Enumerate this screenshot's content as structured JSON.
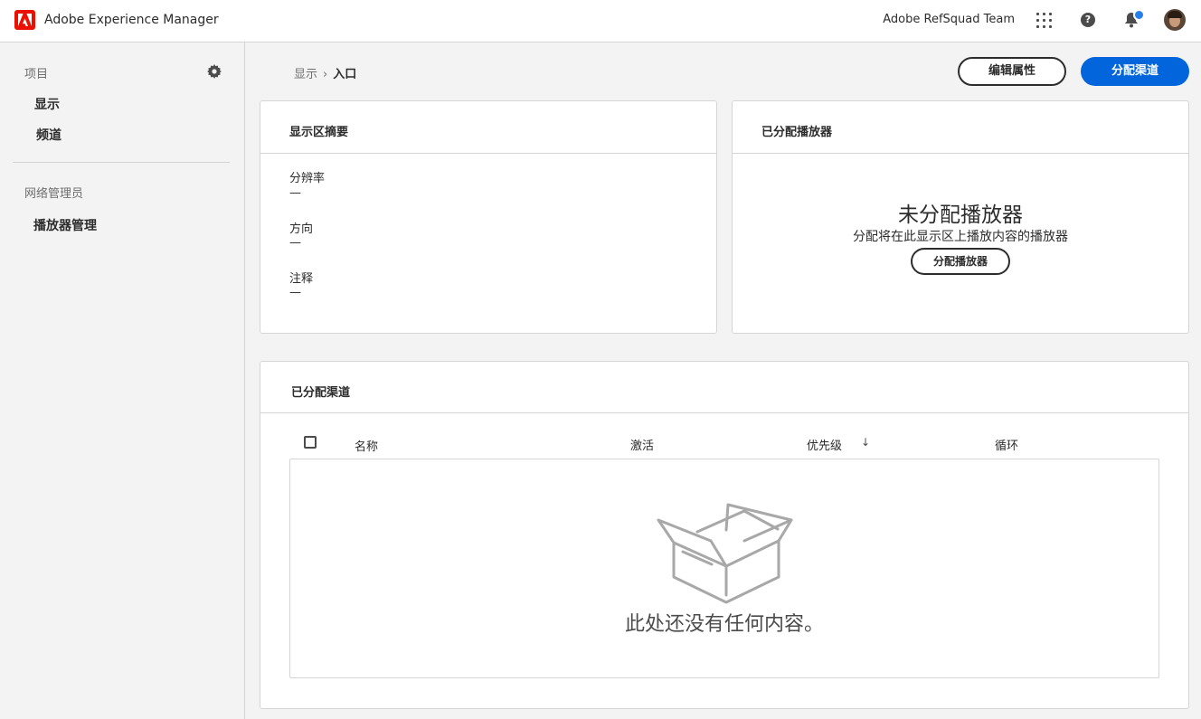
{
  "header": {
    "app_title": "Adobe Experience Manager",
    "org_name": "Adobe RefSquad Team",
    "icons": [
      "adobe-logo-icon",
      "apps-grid-icon",
      "help-icon",
      "bell-icon",
      "avatar"
    ],
    "accent": "#eb1000",
    "notification_color": "#2680eb"
  },
  "sidebar": {
    "section1_heading": "项目",
    "items": [
      {
        "label": "显示"
      },
      {
        "label": "频道"
      }
    ],
    "section2_heading": "网络管理员",
    "admin_items": [
      {
        "label": "播放器管理"
      }
    ]
  },
  "breadcrumb": {
    "parent": "显示",
    "current": "入口"
  },
  "actions": {
    "edit_properties": "编辑属性",
    "assign_channel": "分配渠道",
    "primary_color": "#0265dc"
  },
  "display_summary": {
    "title": "显示区摘要",
    "properties": [
      {
        "label": "分辨率",
        "value": "—"
      },
      {
        "label": "方向",
        "value": "—"
      },
      {
        "label": "注释",
        "value": "—"
      }
    ]
  },
  "assigned_players": {
    "title": "已分配播放器",
    "empty_title": "未分配播放器",
    "empty_desc": "分配将在此显示区上播放内容的播放器",
    "assign_button": "分配播放器"
  },
  "assigned_channels": {
    "title": "已分配渠道",
    "columns": [
      "名称",
      "激活",
      "优先级",
      "循环"
    ],
    "sort_column": "优先级",
    "sort_direction": "descending",
    "empty_message": "此处还没有任何内容。"
  }
}
